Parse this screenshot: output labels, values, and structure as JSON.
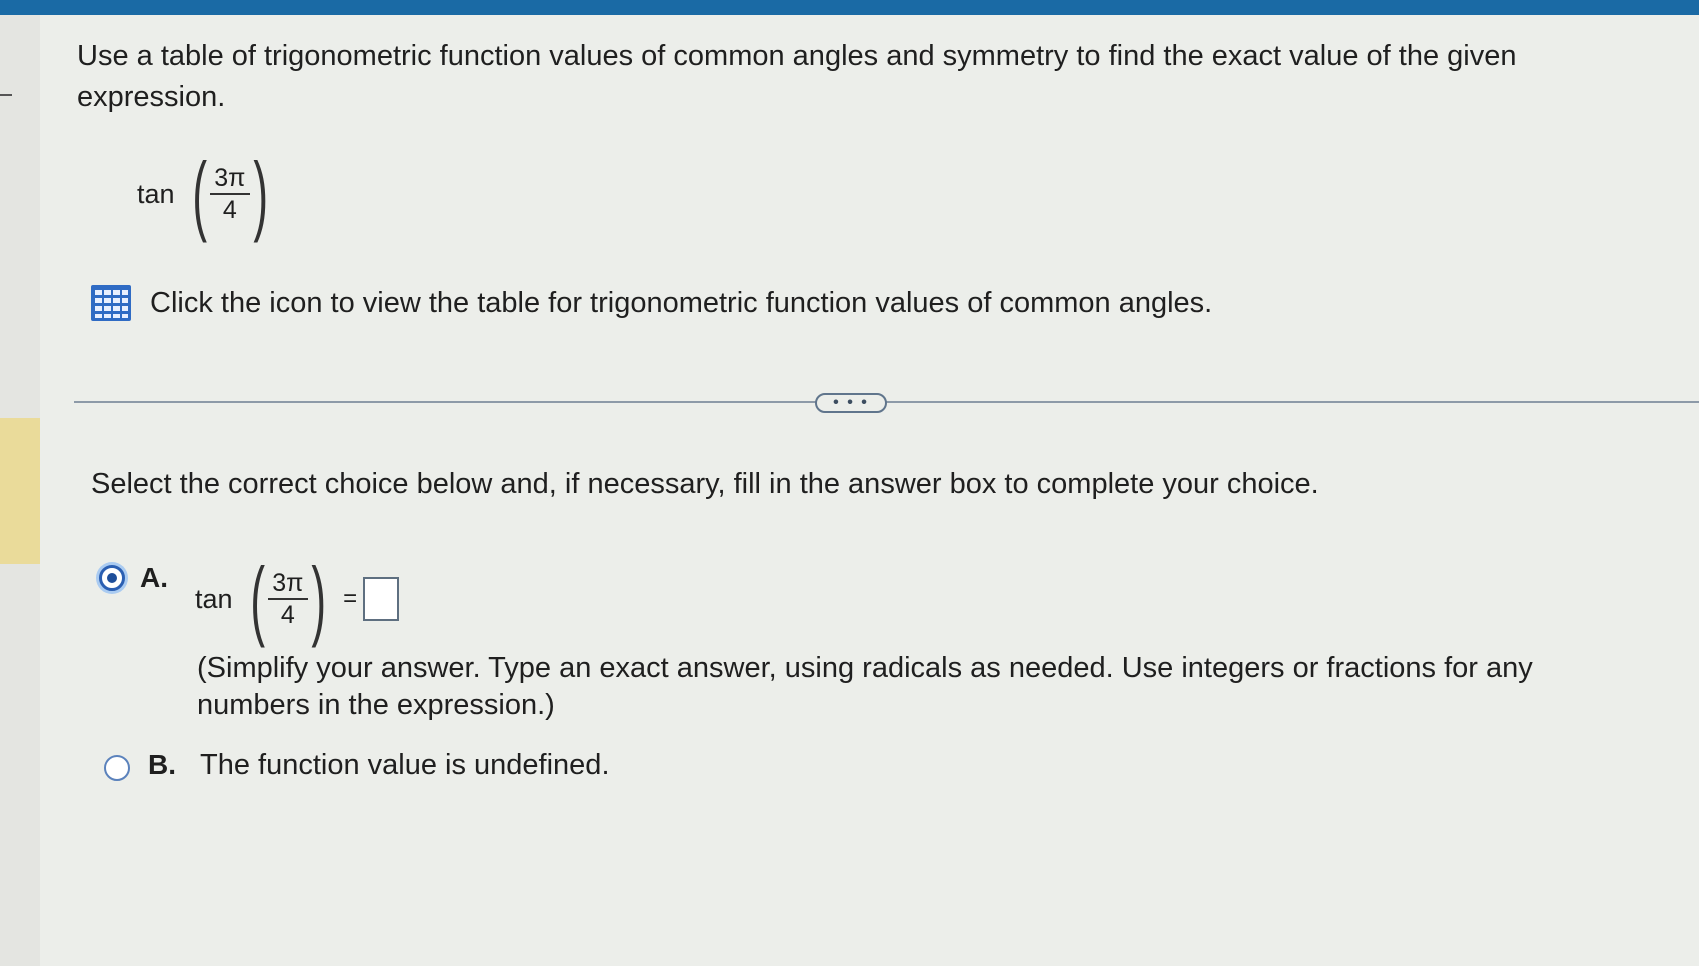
{
  "question": {
    "text": "Use a table of trigonometric function values of common angles and symmetry to find the exact value of the given expression.",
    "expression": {
      "func": "tan",
      "numerator": "3π",
      "denominator": "4"
    }
  },
  "table_link": {
    "icon": "table-grid-icon",
    "text": "Click the icon to view the table for trigonometric function values of common angles."
  },
  "more_button": {
    "label": "• • •"
  },
  "instruction": "Select the correct choice below and, if necessary, fill in the answer box to complete your choice.",
  "choices": {
    "a": {
      "letter": "A.",
      "selected": true,
      "expression": {
        "func": "tan",
        "numerator": "3π",
        "denominator": "4",
        "equals": "="
      },
      "answer_value": "",
      "hint": "(Simplify your answer. Type an exact answer, using radicals as needed. Use integers or fractions for any numbers in the expression.)"
    },
    "b": {
      "letter": "B.",
      "selected": false,
      "text": "The function value is undefined."
    }
  },
  "colors": {
    "top_bar": "#1a6aa5",
    "radio_accent": "#2b5fb2",
    "highlight": "#eadb9a",
    "icon_blue": "#2f6bc4"
  }
}
